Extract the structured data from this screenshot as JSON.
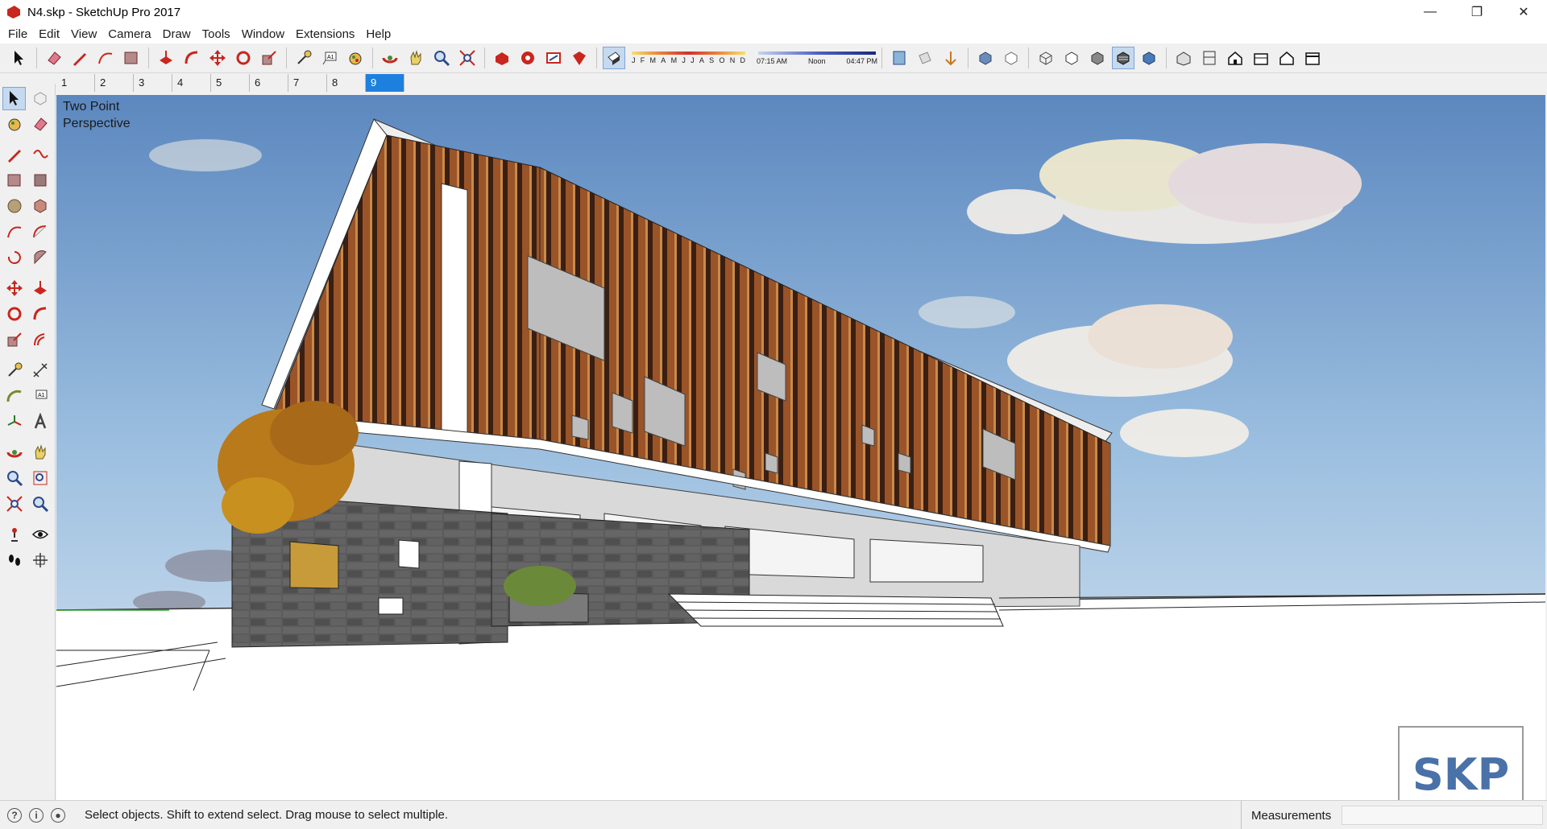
{
  "window": {
    "title": "N4.skp - SketchUp Pro 2017"
  },
  "window_controls": {
    "minimize": "—",
    "restore": "❐",
    "close": "✕"
  },
  "menu": [
    "File",
    "Edit",
    "View",
    "Camera",
    "Draw",
    "Tools",
    "Window",
    "Extensions",
    "Help"
  ],
  "shadow_settings": {
    "months": [
      "J",
      "F",
      "M",
      "A",
      "M",
      "J",
      "J",
      "A",
      "S",
      "O",
      "N",
      "D"
    ],
    "time_start": "07:15 AM",
    "time_mid": "Noon",
    "time_end": "04:47 PM"
  },
  "scenes": [
    "1",
    "2",
    "3",
    "4",
    "5",
    "6",
    "7",
    "8",
    "9"
  ],
  "active_scene": "9",
  "viewport": {
    "camera_mode_line1": "Two Point",
    "camera_mode_line2": "Perspective"
  },
  "badge": {
    "text": "SKP"
  },
  "status": {
    "hint": "Select objects. Shift to extend select. Drag mouse to select multiple.",
    "measurements_label": "Measurements",
    "measurements_value": ""
  },
  "colors": {
    "accent": "#1e80de",
    "tool_red": "#c8261e",
    "sky_top": "#6a96c8",
    "wood": "#8a4a22"
  }
}
